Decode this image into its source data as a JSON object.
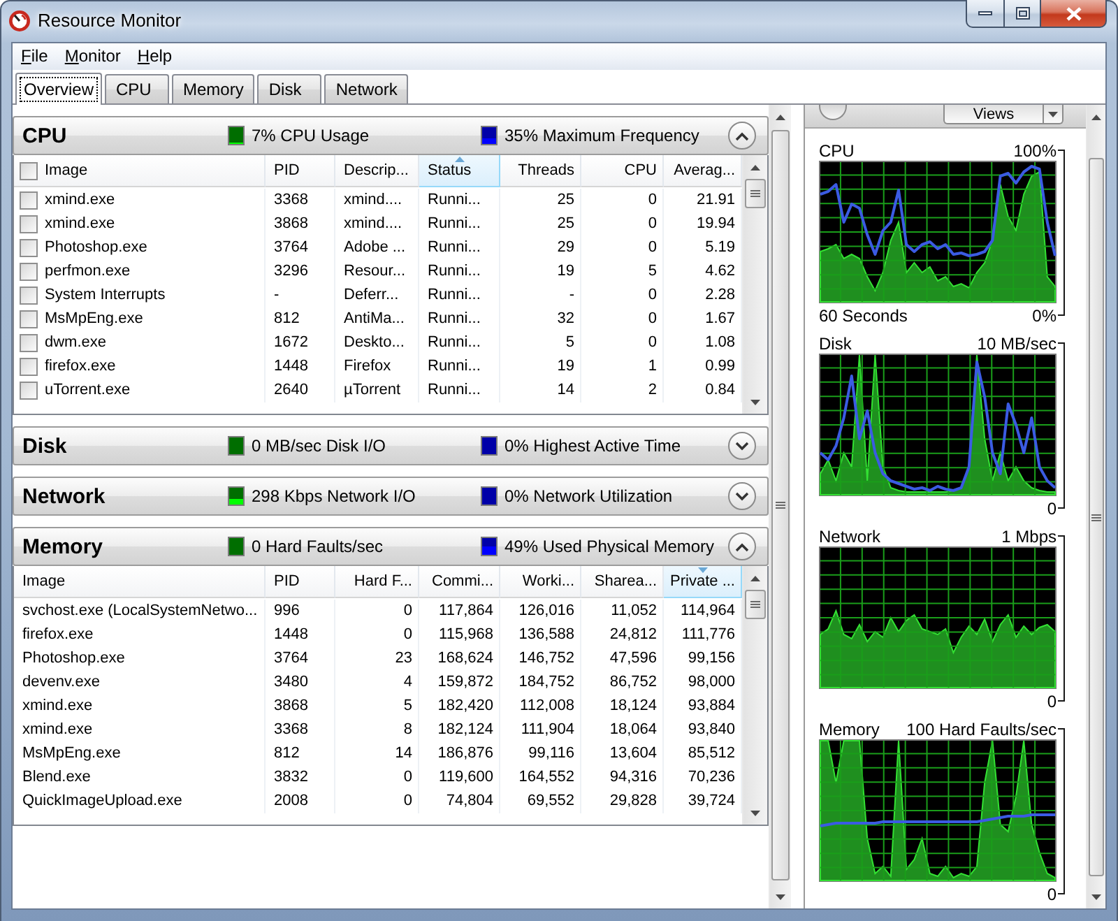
{
  "window": {
    "title": "Resource Monitor"
  },
  "menu": [
    {
      "label": "File",
      "access_key_underlined": true
    },
    {
      "label": "Monitor",
      "access_key_underlined": true
    },
    {
      "label": "Help",
      "access_key_underlined": true
    }
  ],
  "tabs": [
    {
      "label": "Overview",
      "selected": true
    },
    {
      "label": "CPU",
      "selected": false
    },
    {
      "label": "Memory",
      "selected": false
    },
    {
      "label": "Disk",
      "selected": false
    },
    {
      "label": "Network",
      "selected": false
    }
  ],
  "sections": [
    {
      "title": "CPU",
      "expanded": true,
      "metrics": [
        {
          "text": "7% CPU Usage",
          "color": "#006e00",
          "level": 0.07
        },
        {
          "text": "35% Maximum Frequency",
          "color": "#0000a8",
          "level": 0.35
        }
      ],
      "table": {
        "kind": "checkable",
        "all_checked": false,
        "columns": [
          {
            "label": "Image",
            "kind": "text",
            "sorted_ascending": false,
            "sorted_descending": false
          },
          {
            "label": "PID",
            "kind": "text",
            "sorted_ascending": false,
            "sorted_descending": false
          },
          {
            "label": "Descrip...",
            "kind": "text",
            "sorted_ascending": false,
            "sorted_descending": false
          },
          {
            "label": "Status",
            "kind": "text",
            "sorted_ascending": true,
            "sorted_descending": false
          },
          {
            "label": "Threads",
            "kind": "number",
            "sorted_ascending": false,
            "sorted_descending": false
          },
          {
            "label": "CPU",
            "kind": "number",
            "sorted_ascending": false,
            "sorted_descending": false
          },
          {
            "label": "Averag...",
            "kind": "number",
            "sorted_ascending": false,
            "sorted_descending": false
          }
        ],
        "rows": [
          {
            "checked": false,
            "cells": [
              "xmind.exe",
              "3368",
              "xmind....",
              "Runni...",
              "25",
              "0",
              "21.91"
            ]
          },
          {
            "checked": false,
            "cells": [
              "xmind.exe",
              "3868",
              "xmind....",
              "Runni...",
              "25",
              "0",
              "19.94"
            ]
          },
          {
            "checked": false,
            "cells": [
              "Photoshop.exe",
              "3764",
              "Adobe ...",
              "Runni...",
              "29",
              "0",
              "5.19"
            ]
          },
          {
            "checked": false,
            "cells": [
              "perfmon.exe",
              "3296",
              "Resour...",
              "Runni...",
              "19",
              "5",
              "4.62"
            ]
          },
          {
            "checked": false,
            "cells": [
              "System Interrupts",
              "-",
              "Deferr...",
              "Runni...",
              "-",
              "0",
              "2.28"
            ]
          },
          {
            "checked": false,
            "cells": [
              "MsMpEng.exe",
              "812",
              "AntiMa...",
              "Runni...",
              "32",
              "0",
              "1.67"
            ]
          },
          {
            "checked": false,
            "cells": [
              "dwm.exe",
              "1672",
              "Deskto...",
              "Runni...",
              "5",
              "0",
              "1.08"
            ]
          },
          {
            "checked": false,
            "cells": [
              "firefox.exe",
              "1448",
              "Firefox",
              "Runni...",
              "19",
              "1",
              "0.99"
            ]
          },
          {
            "checked": false,
            "cells": [
              "uTorrent.exe",
              "2640",
              "µTorrent",
              "Runni...",
              "14",
              "2",
              "0.84"
            ]
          }
        ]
      }
    },
    {
      "title": "Disk",
      "expanded": false,
      "metrics": [
        {
          "text": "0 MB/sec Disk I/O",
          "color": "#006e00"
        },
        {
          "text": "0% Highest Active Time",
          "color": "#0000a8"
        }
      ]
    },
    {
      "title": "Network",
      "expanded": false,
      "metrics": [
        {
          "text": "298 Kbps Network I/O",
          "color": "#006e00",
          "level": 0.3
        },
        {
          "text": "0% Network Utilization",
          "color": "#0000a8"
        }
      ]
    },
    {
      "title": "Memory",
      "expanded": true,
      "metrics": [
        {
          "text": "0 Hard Faults/sec",
          "color": "#006e00"
        },
        {
          "text": "49% Used Physical Memory",
          "color": "#0000a8",
          "level": 0.49
        }
      ],
      "table": {
        "kind": "plain",
        "columns": [
          {
            "label": "Image",
            "kind": "text",
            "sorted_ascending": false,
            "sorted_descending": false
          },
          {
            "label": "PID",
            "kind": "text",
            "sorted_ascending": false,
            "sorted_descending": false
          },
          {
            "label": "Hard F...",
            "kind": "number",
            "sorted_ascending": false,
            "sorted_descending": false
          },
          {
            "label": "Commi...",
            "kind": "number",
            "sorted_ascending": false,
            "sorted_descending": false
          },
          {
            "label": "Worki...",
            "kind": "number",
            "sorted_ascending": false,
            "sorted_descending": false
          },
          {
            "label": "Sharea...",
            "kind": "number",
            "sorted_ascending": false,
            "sorted_descending": false
          },
          {
            "label": "Private ...",
            "kind": "number",
            "sorted_ascending": false,
            "sorted_descending": true
          }
        ],
        "rows": [
          {
            "cells": [
              "svchost.exe (LocalSystemNetwo...",
              "996",
              "0",
              "117,864",
              "126,016",
              "11,052",
              "114,964"
            ]
          },
          {
            "cells": [
              "firefox.exe",
              "1448",
              "0",
              "115,968",
              "136,588",
              "24,812",
              "111,776"
            ]
          },
          {
            "cells": [
              "Photoshop.exe",
              "3764",
              "23",
              "168,624",
              "146,752",
              "47,596",
              "99,156"
            ]
          },
          {
            "cells": [
              "devenv.exe",
              "3480",
              "4",
              "159,872",
              "184,752",
              "86,752",
              "98,000"
            ]
          },
          {
            "cells": [
              "xmind.exe",
              "3868",
              "5",
              "182,420",
              "112,008",
              "18,124",
              "93,884"
            ]
          },
          {
            "cells": [
              "xmind.exe",
              "3368",
              "8",
              "182,124",
              "111,904",
              "18,064",
              "93,840"
            ]
          },
          {
            "cells": [
              "MsMpEng.exe",
              "812",
              "14",
              "186,876",
              "99,116",
              "13,604",
              "85,512"
            ]
          },
          {
            "cells": [
              "Blend.exe",
              "3832",
              "0",
              "119,600",
              "164,552",
              "94,316",
              "70,236"
            ]
          },
          {
            "cells": [
              "QuickImageUpload.exe",
              "2008",
              "0",
              "74,804",
              "69,552",
              "29,828",
              "39,724"
            ]
          }
        ]
      }
    }
  ],
  "graph_toolbar": {
    "views_button": "Views"
  },
  "graphs": [
    {
      "title": "CPU",
      "scale_max": "100%",
      "scale_min": "0%",
      "time_span": "60 Seconds"
    },
    {
      "title": "Disk",
      "scale_max": "10 MB/sec",
      "scale_min": "0"
    },
    {
      "title": "Network",
      "scale_max": "1 Mbps",
      "scale_min": "0"
    },
    {
      "title": "Memory",
      "scale_max": "100 Hard Faults/sec",
      "scale_min": "0"
    }
  ]
}
